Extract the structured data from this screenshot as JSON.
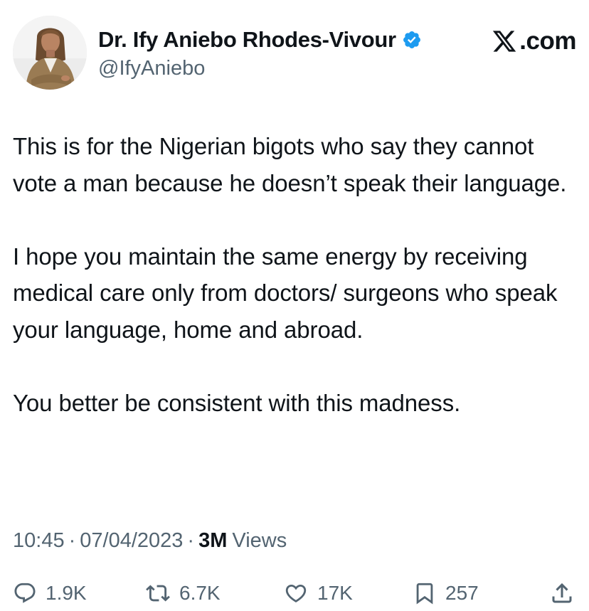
{
  "author": {
    "display_name": "Dr. Ify Aniebo Rhodes-Vivour",
    "handle": "@IfyAniebo",
    "verified_icon": "verified-badge-icon"
  },
  "brand": {
    "label": ".com",
    "icon": "x-logo-icon"
  },
  "tweet": {
    "paragraphs": [
      "This is for the Nigerian bigots who say they cannot vote a man because he doesn’t speak their language.",
      "I hope you maintain the same energy by receiving medical care only from doctors/ surgeons who speak your language, home and abroad.",
      "You better be consistent with this madness."
    ]
  },
  "meta": {
    "time": "10:45",
    "separator": "·",
    "date": "07/04/2023",
    "views_count": "3M",
    "views_label": "Views"
  },
  "actions": {
    "replies": "1.9K",
    "reposts": "6.7K",
    "likes": "17K",
    "bookmarks": "257"
  },
  "colors": {
    "text": "#0f1419",
    "secondary": "#536471",
    "verified": "#1d9bf0"
  }
}
